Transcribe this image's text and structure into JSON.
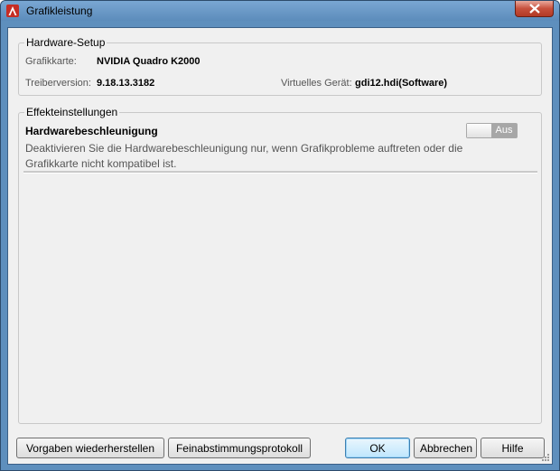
{
  "window": {
    "title": "Grafikleistung"
  },
  "hardware_setup": {
    "legend": "Hardware-Setup",
    "graphics_card_label": "Grafikkarte:",
    "graphics_card_value": "NVIDIA Quadro K2000",
    "driver_version_label": "Treiberversion:",
    "driver_version_value": "9.18.13.3182",
    "virtual_device_label": "Virtuelles Gerät:",
    "virtual_device_value": "gdi12.hdi(Software)"
  },
  "effects": {
    "legend": "Effekteinstellungen",
    "hw_accel_title": "Hardwarebeschleunigung",
    "hw_accel_desc": "Deaktivieren Sie die Hardwarebeschleunigung nur, wenn Grafikprobleme auftreten oder die Grafikkarte nicht kompatibel ist.",
    "toggle_state_label": "Aus"
  },
  "buttons": {
    "restore_defaults": "Vorgaben wiederherstellen",
    "tuning_log": "Feinabstimmungsprotokoll",
    "ok": "OK",
    "cancel": "Abbrechen",
    "help": "Hilfe"
  },
  "colors": {
    "title_bar": "#5e8fbd",
    "close_button": "#c7503c",
    "toggle_off": "#a7a7a7"
  }
}
